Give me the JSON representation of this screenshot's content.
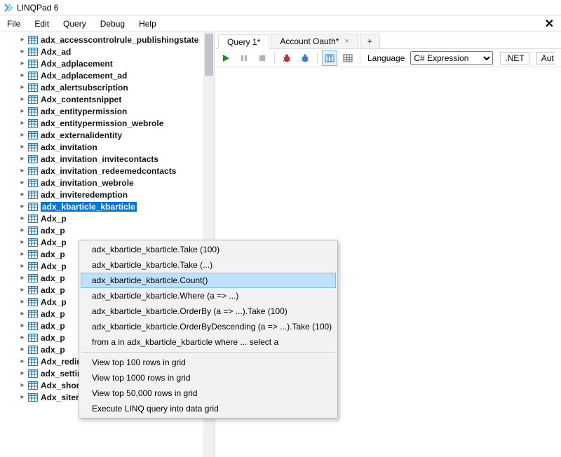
{
  "app": {
    "title": "LINQPad 6"
  },
  "menu": {
    "items": [
      "File",
      "Edit",
      "Query",
      "Debug",
      "Help"
    ],
    "close_glyph": "✕"
  },
  "tabs": {
    "items": [
      {
        "label": "Query 1*"
      },
      {
        "label": "Account Oauth*"
      }
    ],
    "add_label": "+"
  },
  "toolbar": {
    "language_label": "Language",
    "language_value": "C# Expression",
    "net_label": ".NET",
    "aut_label": "Aut"
  },
  "tree": {
    "items": [
      "adx_accesscontrolrule_publishingstate",
      "Adx_ad",
      "Adx_adplacement",
      "Adx_adplacement_ad",
      "adx_alertsubscription",
      "Adx_contentsnippet",
      "adx_entitypermission",
      "adx_entitypermission_webrole",
      "adx_externalidentity",
      "adx_invitation",
      "adx_invitation_invitecontacts",
      "adx_invitation_redeemedcontacts",
      "adx_invitation_webrole",
      "adx_inviteredemption",
      "adx_kbarticle_kbarticle",
      "Adx_p",
      "adx_p",
      "Adx_p",
      "adx_p",
      "Adx_p",
      "adx_p",
      "adx_p",
      "Adx_p",
      "adx_p",
      "adx_p",
      "adx_p",
      "adx_p",
      "Adx_redirect",
      "adx_setting",
      "Adx_shortcut",
      "Adx_sitemarker"
    ],
    "selected_index": 14
  },
  "context_menu": {
    "items": [
      "adx_kbarticle_kbarticle.Take (100)",
      "adx_kbarticle_kbarticle.Take (...)",
      "adx_kbarticle_kbarticle.Count()",
      "adx_kbarticle_kbarticle.Where (a => ...)",
      "adx_kbarticle_kbarticle.OrderBy (a => ...).Take (100)",
      "adx_kbarticle_kbarticle.OrderByDescending (a => ...).Take (100)",
      "from a in adx_kbarticle_kbarticle where ...  select a"
    ],
    "grid_items": [
      "View top 100 rows in grid",
      "View top 1000 rows in grid",
      "View top 50,000 rows in grid",
      "Execute LINQ query into data grid"
    ],
    "highlight_index": 2
  }
}
